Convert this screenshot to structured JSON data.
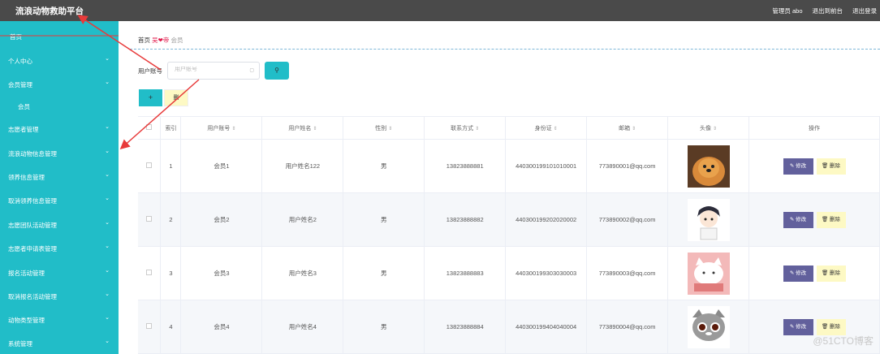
{
  "header": {
    "title": "流浪动物救助平台",
    "admin": "管理员 abo",
    "front": "退出到前台",
    "logout": "退出登录"
  },
  "sidebar": {
    "home": "首页",
    "items": [
      {
        "label": "个人中心"
      },
      {
        "label": "会员管理"
      },
      {
        "label": "志愿者管理"
      },
      {
        "label": "流浪动物信息管理"
      },
      {
        "label": "领养信息管理"
      },
      {
        "label": "取消领养信息管理"
      },
      {
        "label": "志愿团队活动管理"
      },
      {
        "label": "志愿者申请表管理"
      },
      {
        "label": "报名活动管理"
      },
      {
        "label": "取消报名活动管理"
      },
      {
        "label": "动物类型管理"
      },
      {
        "label": "系统管理"
      }
    ],
    "sub_item": "会员",
    "chevron": "chevron-down-icon"
  },
  "breadcrumb": {
    "home": "首页",
    "brand": "吴❤帝",
    "current": "会员"
  },
  "search": {
    "label": "用户账号",
    "placeholder": "用户账号",
    "value": "",
    "button_icon": "search-icon"
  },
  "toolbar": {
    "add_label": "+",
    "delete_label": "删"
  },
  "table": {
    "columns": [
      "",
      "索引",
      "用户账号",
      "用户姓名",
      "性别",
      "联系方式",
      "身份证",
      "邮箱",
      "头像",
      "操作"
    ],
    "rows": [
      {
        "index": "1",
        "account": "会员1",
        "name": "用户姓名122",
        "gender": "男",
        "phone": "13823888881",
        "idcard": "440300199101010001",
        "email": "773890001@qq.com",
        "avatar": "dog-photo"
      },
      {
        "index": "2",
        "account": "会员2",
        "name": "用户姓名2",
        "gender": "男",
        "phone": "13823888882",
        "idcard": "440300199202020002",
        "email": "773890002@qq.com",
        "avatar": "cartoon-boy"
      },
      {
        "index": "3",
        "account": "会员3",
        "name": "用户姓名3",
        "gender": "男",
        "phone": "13823888883",
        "idcard": "440300199303030003",
        "email": "773890003@qq.com",
        "avatar": "cartoon-cat-pink"
      },
      {
        "index": "4",
        "account": "会员4",
        "name": "用户姓名4",
        "gender": "男",
        "phone": "13823888884",
        "idcard": "440300199404040004",
        "email": "773890004@qq.com",
        "avatar": "cartoon-cat-gray"
      }
    ],
    "edit_label": "✎ 修改",
    "delete_label": "🗑 删除"
  },
  "watermark": "@51CTO博客",
  "colors": {
    "header_bg": "#4a4a4a",
    "sidebar_bg": "#21bdc8",
    "edit_btn": "#62609c",
    "delete_btn": "#fdf9c4",
    "arrow": "#e83a3a"
  }
}
